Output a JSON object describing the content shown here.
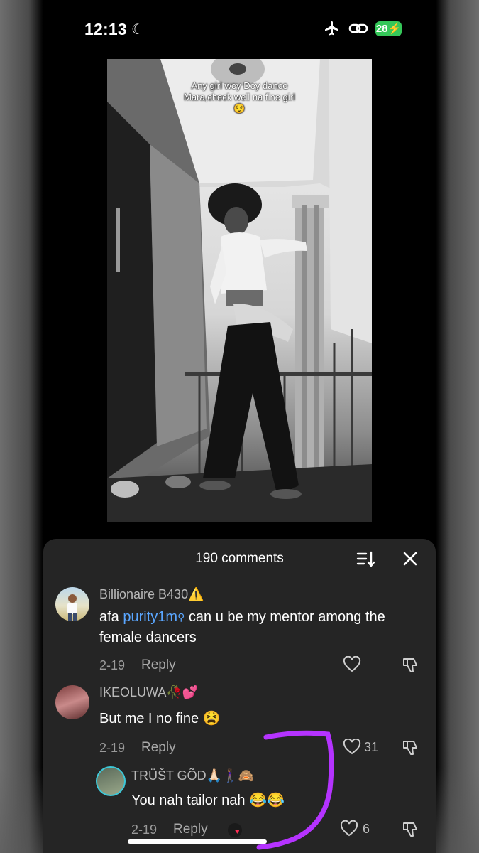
{
  "status_bar": {
    "time": "12:13",
    "battery": "28",
    "icons": [
      "moon-icon",
      "airplane-icon",
      "link-icon",
      "battery-icon"
    ]
  },
  "video": {
    "caption_line1": "Any girl wey Dey dance",
    "caption_line2": "Mara,check well na fine girl",
    "caption_emoji": "😌"
  },
  "comments_sheet": {
    "title": "190 comments",
    "comments": [
      {
        "username": "Billionaire B430⚠️",
        "text_before": "afa ",
        "mention": "purity1m",
        "text_after": " can u be my mentor among the female dancers",
        "date": "2-19",
        "reply_label": "Reply",
        "likes": ""
      },
      {
        "username": "IKEOLUWA🥀💕",
        "text": "But me I no fine 😫",
        "date": "2-19",
        "reply_label": "Reply",
        "likes": "31"
      },
      {
        "username": "TRÜŠT GÕD🙏🏻🚶🏾‍♀️🙈",
        "text": "You nah tailor nah 😂😂",
        "date": "2-19",
        "reply_label": "Reply",
        "likes": "6"
      }
    ]
  },
  "colors": {
    "sheet_bg": "#252525",
    "mention": "#5aa6ff",
    "battery": "#35c759",
    "annotation": "#b533ff"
  }
}
